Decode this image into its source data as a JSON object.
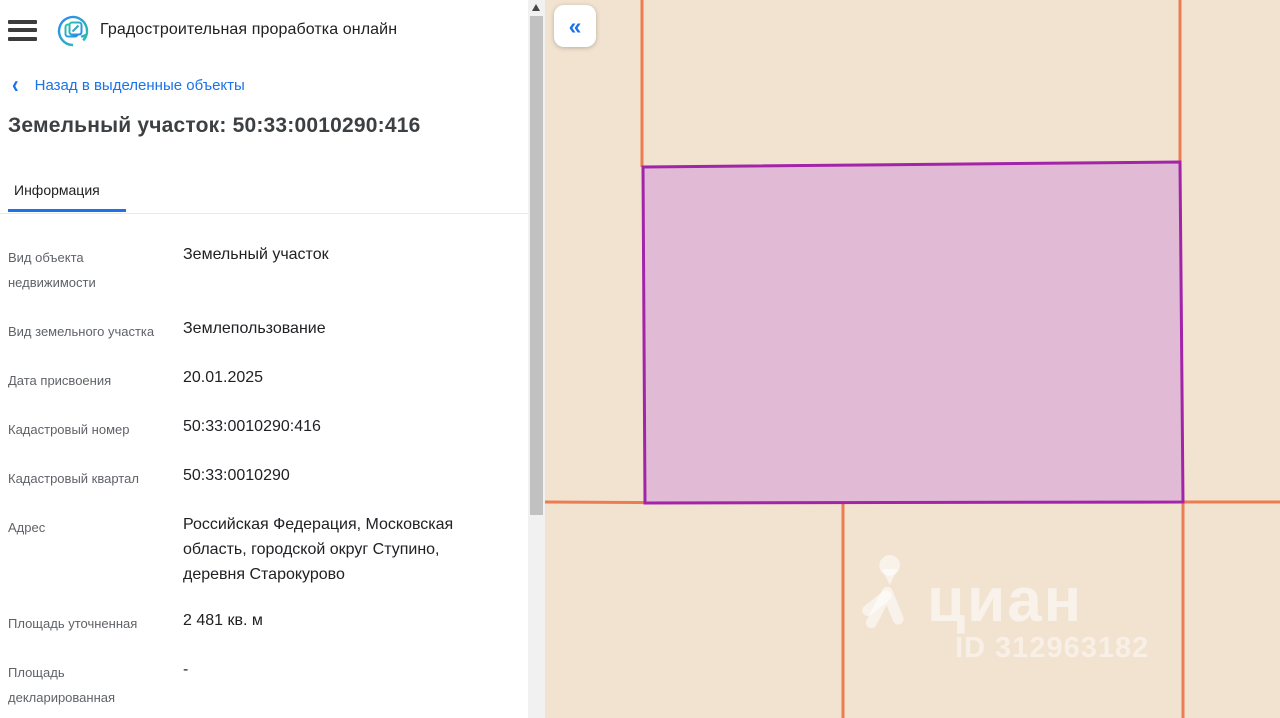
{
  "header": {
    "title": "Градостроительная проработка онлайн"
  },
  "back_link": {
    "chevron": "‹",
    "label": "Назад в выделенные объекты"
  },
  "page_title": "Земельный участок: 50:33:0010290:416",
  "tabs": [
    {
      "label": "Информация",
      "active": true
    }
  ],
  "info_rows": [
    {
      "label": "Вид объекта недвижимости",
      "value": "Земельный участок"
    },
    {
      "label": "Вид земельного участка",
      "value": "Землепользование"
    },
    {
      "label": "Дата присвоения",
      "value": "20.01.2025"
    },
    {
      "label": "Кадастровый номер",
      "value": "50:33:0010290:416"
    },
    {
      "label": "Кадастровый квартал",
      "value": "50:33:0010290"
    },
    {
      "label": "Адрес",
      "value": "Российская Федерация, Московская область, городской округ Ступино, деревня Старокурово"
    },
    {
      "label": "Площадь уточненная",
      "value": "2 481 кв. м"
    },
    {
      "label": "Площадь декларированная",
      "value": "-"
    }
  ],
  "map": {
    "collapse_button_glyph": "«",
    "watermark": {
      "brand": "циан",
      "id_text": "ID 312963182"
    },
    "colors": {
      "background": "#f2e3d0",
      "cadastral_line": "#ec7c51",
      "parcel_fill": "#e1bbd6",
      "parcel_border": "#a224a8",
      "accent_blue": "#1a73e8"
    }
  }
}
